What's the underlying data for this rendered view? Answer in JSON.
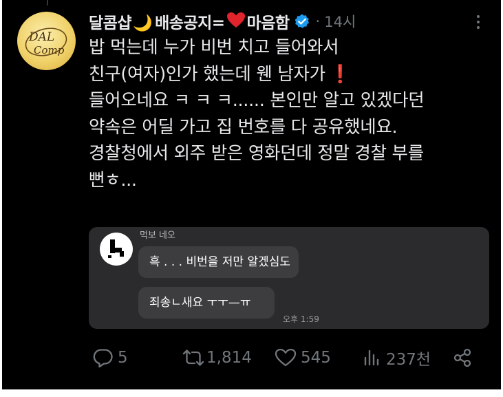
{
  "post": {
    "display_name": "달콤샵",
    "moon_emoji": "🌙",
    "name_text": "배송공지=",
    "heart_emoji": "❤",
    "name_suffix": "마음함",
    "separator": "·",
    "time_ago": "14시",
    "avatar_text_1": "DAL",
    "avatar_text_2": "Comp",
    "body_lines": [
      "밥 먹는데 누가 비번 치고 들어와서",
      "친구(여자)인가 했는데 웬 남자가",
      "들어오네요 ㅋ ㅋ ㅋ...... 본인만 알고 있겠다던",
      "약속은 어딜 가고 집 번호를 다 공유했네요.",
      "경찰청에서 외주 받은 영화던데 정말 경찰 부를",
      "뻔ㅎ..."
    ],
    "exclamation": "❗"
  },
  "chat": {
    "sender": "먹보 네오",
    "message_1": "흑 . . . 비번을 저만 알겠심도",
    "message_2": "죄송ㄴ새요 ㅜㅜ—ㅠ",
    "time": "오후 1:59"
  },
  "actions": {
    "replies": "5",
    "reposts": "1,814",
    "likes": "545",
    "views": "237천"
  },
  "colors": {
    "background": "#000000",
    "text": "#e7e9ea",
    "muted": "#71767b",
    "verified": "#1d9bf0",
    "heart": "#e0242c"
  }
}
